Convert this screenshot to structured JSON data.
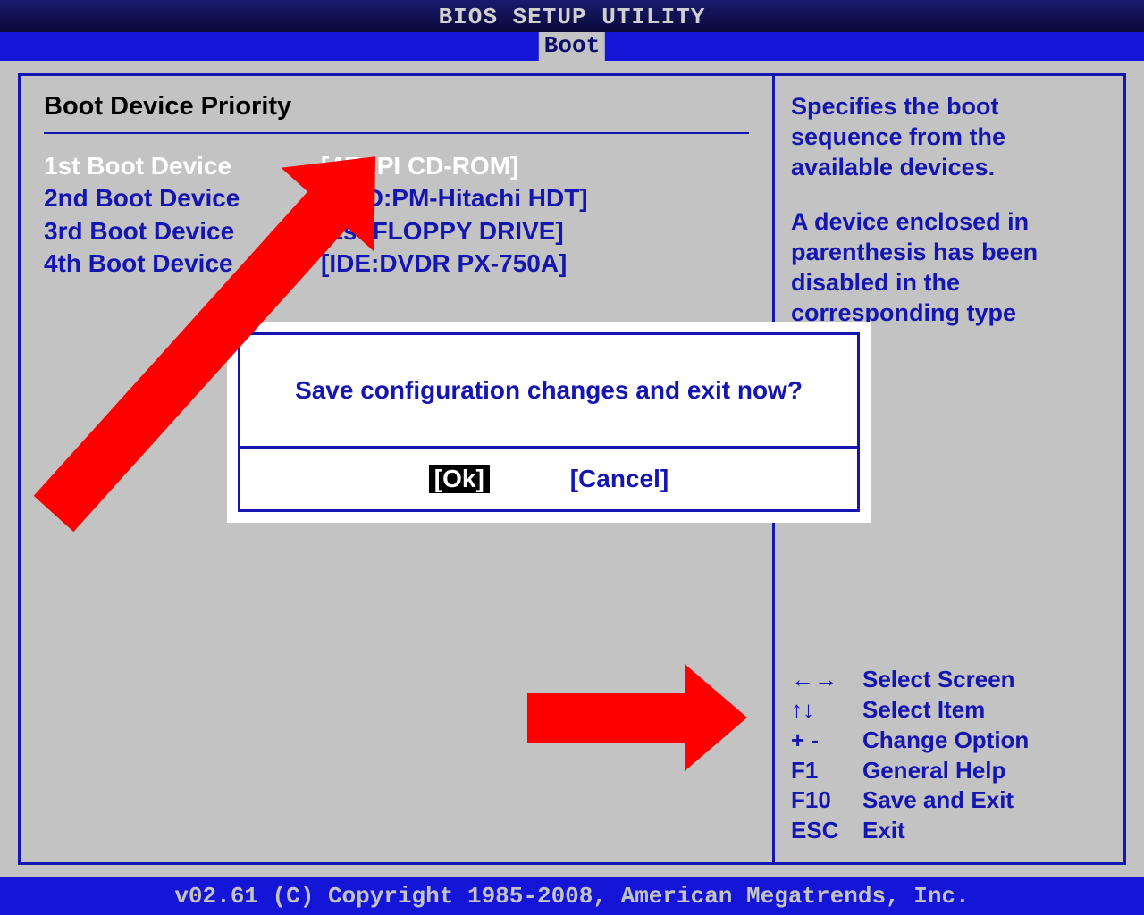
{
  "header": {
    "title": "BIOS SETUP UTILITY",
    "tab": "Boot"
  },
  "panel": {
    "section_title": "Boot Device Priority",
    "rows": [
      {
        "label": "1st Boot Device",
        "value": "[ATAPI CD-ROM]",
        "selected": true
      },
      {
        "label": "2nd Boot Device",
        "value": "[HDD:PM-Hitachi HDT]",
        "selected": false
      },
      {
        "label": "3rd Boot Device",
        "value": "[1st FLOPPY DRIVE]",
        "selected": false
      },
      {
        "label": "4th Boot Device",
        "value": "[IDE:DVDR PX-750A]",
        "selected": false
      }
    ]
  },
  "help": {
    "p1": "Specifies the boot sequence from the available devices.",
    "p2": "A device enclosed in parenthesis has been disabled in the corresponding type"
  },
  "keys": [
    {
      "key": "←→",
      "action": "Select Screen"
    },
    {
      "key": "↑↓",
      "action": "Select Item"
    },
    {
      "key": "+ -",
      "action": "Change Option"
    },
    {
      "key": "F1",
      "action": "General Help"
    },
    {
      "key": "F10",
      "action": "Save and Exit"
    },
    {
      "key": "ESC",
      "action": "Exit"
    }
  ],
  "dialog": {
    "message": "Save configuration changes and exit now?",
    "ok": "[Ok]",
    "cancel": "[Cancel]"
  },
  "footer": "v02.61 (C) Copyright 1985-2008, American Megatrends, Inc."
}
